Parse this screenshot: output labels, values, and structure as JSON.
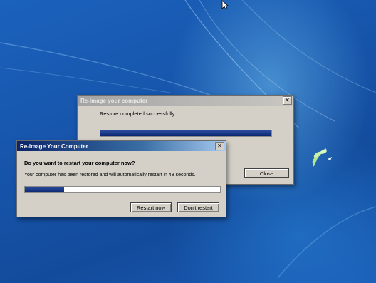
{
  "back_dialog": {
    "title": "Re-image your computer",
    "message": "Restore completed successfully.",
    "progress": 1.0,
    "close_label": "Close"
  },
  "front_dialog": {
    "title": "Re-image Your Computer",
    "question": "Do you want to restart your computer now?",
    "message": "Your computer has been restored and will automatically restart in 48 seconds.",
    "progress": 0.2,
    "restart_now_label": "Restart now",
    "dont_restart_label": "Don't restart"
  },
  "icons": [
    "close-icon",
    "mouse-cursor-icon",
    "windows-logo-icon"
  ],
  "colors": {
    "desktop": "#1a5ab2",
    "dialog_face": "#d4d0c8",
    "progress_fill": "#0a2670",
    "active_title": "#0a246a"
  }
}
